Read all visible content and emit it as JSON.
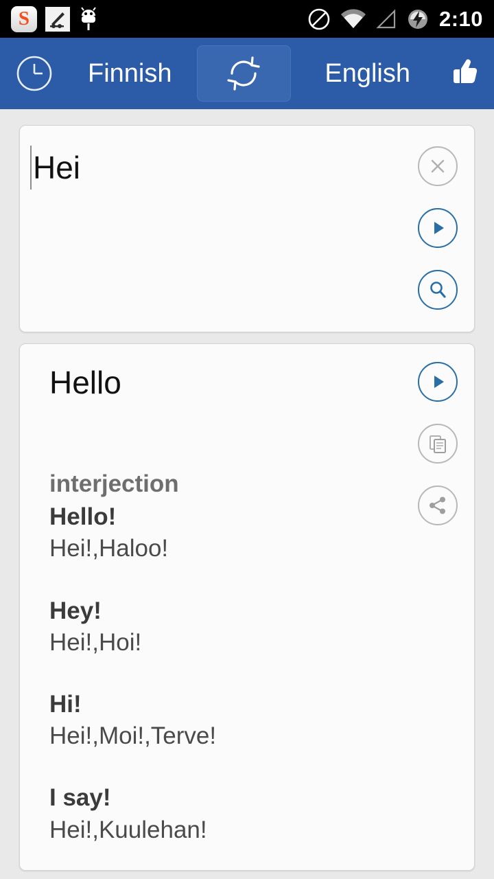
{
  "status_bar": {
    "time": "2:10",
    "left_icons": [
      "sogou-app-icon",
      "notification-icon",
      "android-robot-icon"
    ],
    "right_icons": [
      "do-not-disturb-icon",
      "wifi-icon",
      "cellular-signal-icon",
      "battery-charging-icon"
    ]
  },
  "header": {
    "history_icon": "clock-icon",
    "source_language": "Finnish",
    "swap_icon": "swap-languages-icon",
    "target_language": "English",
    "favorite_icon": "thumbs-up-icon",
    "background_color": "#2c5ba8"
  },
  "input_card": {
    "text": "Hei",
    "clear_icon": "close-icon",
    "speak_icon": "play-icon",
    "search_icon": "search-icon"
  },
  "result_card": {
    "translation": "Hello",
    "speak_icon": "play-icon",
    "copy_icon": "copy-icon",
    "share_icon": "share-icon",
    "part_of_speech": "interjection",
    "entries": [
      {
        "term": "Hello!",
        "translations": "Hei!,Haloo!"
      },
      {
        "term": "Hey!",
        "translations": "Hei!,Hoi!"
      },
      {
        "term": "Hi!",
        "translations": "Hei!,Moi!,Terve!"
      },
      {
        "term": "I say!",
        "translations": "Hei!,Kuulehan!"
      }
    ]
  },
  "colors": {
    "accent_blue": "#2a6ea6",
    "header_blue": "#2c5ba8",
    "page_background": "#e9e9e9",
    "card_background": "#fbfbfb"
  }
}
